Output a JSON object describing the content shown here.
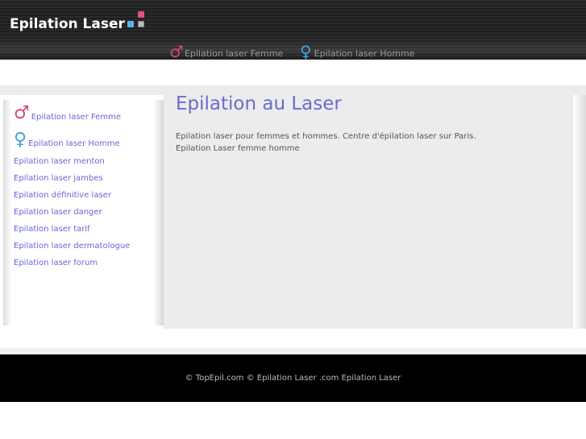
{
  "header": {
    "site_title": "Epilation Laser",
    "nav": [
      {
        "icon": "male-symbol-icon",
        "symbol": "♂",
        "label": "Epilation laser Femme"
      },
      {
        "icon": "female-symbol-icon",
        "symbol": "♀",
        "label": "Epilation laser Homme"
      }
    ]
  },
  "sidebar": {
    "items": [
      {
        "symbol": "♂",
        "label": "Epilation laser Femme"
      },
      {
        "symbol": "♀",
        "label": "Epilation laser Homme"
      },
      {
        "label": "Epilation laser menton"
      },
      {
        "label": "Epilation laser jambes"
      },
      {
        "label": "Epilation définitive laser"
      },
      {
        "label": "Epilation laser danger"
      },
      {
        "label": "Epilation laser tarif"
      },
      {
        "label": "Epilation laser dermatologue"
      },
      {
        "label": "Epilation laser forum"
      }
    ]
  },
  "main": {
    "title": "Epilation au Laser",
    "line1": "Epilation laser pour femmes et hommes. Centre d'épilation laser sur Paris.",
    "line2": "Epilation Laser femme homme"
  },
  "footer": {
    "text": "© TopEpil.com © Epilation Laser .com Epilation Laser"
  },
  "colors": {
    "link": "#6667d6",
    "title": "#6a6bd0",
    "male_symbol": "#d4457a",
    "female_symbol": "#3ea6d8"
  }
}
